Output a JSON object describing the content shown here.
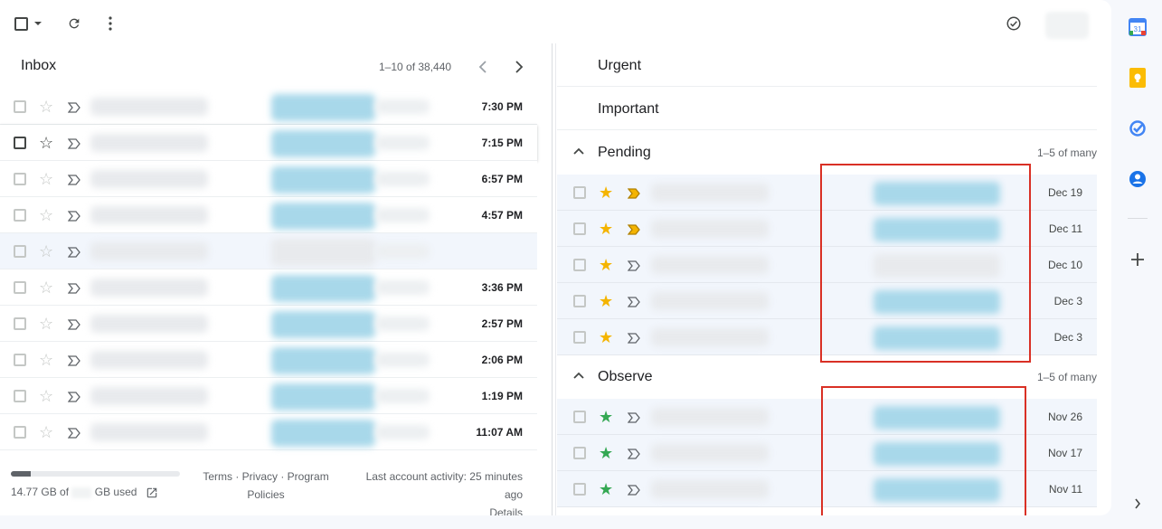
{
  "toolbar": {
    "select_icon": "checkbox-icon",
    "refresh_icon": "refresh-icon",
    "more_icon": "more-vert-icon",
    "tasks_icon": "check-circle-icon"
  },
  "inbox": {
    "title": "Inbox",
    "pager": "1–10 of 38,440",
    "rows": [
      {
        "time": "7:30 PM",
        "read": false
      },
      {
        "time": "7:15 PM",
        "read": false
      },
      {
        "time": "6:57 PM",
        "read": false
      },
      {
        "time": "4:57 PM",
        "read": false
      },
      {
        "time": "",
        "read": true
      },
      {
        "time": "3:36 PM",
        "read": false
      },
      {
        "time": "2:57 PM",
        "read": false
      },
      {
        "time": "2:06 PM",
        "read": false
      },
      {
        "time": "1:19 PM",
        "read": false
      },
      {
        "time": "11:07 AM",
        "read": false
      }
    ]
  },
  "footer": {
    "storage_used": "14.77 GB of",
    "storage_suffix": "GB used",
    "storage_fraction": 0.12,
    "terms": "Terms",
    "privacy": "Privacy",
    "program_policies": "Program Policies",
    "sep": " · ",
    "activity": "Last account activity: 25 minutes ago",
    "details": "Details"
  },
  "sections": {
    "urgent": "Urgent",
    "important": "Important",
    "pending": {
      "title": "Pending",
      "count": "1–5 of many",
      "rows": [
        {
          "date": "Dec 19",
          "important": true
        },
        {
          "date": "Dec 11",
          "important": true
        },
        {
          "date": "Dec 10",
          "important": false
        },
        {
          "date": "Dec 3",
          "important": false
        },
        {
          "date": "Dec 3",
          "important": false
        }
      ]
    },
    "observe": {
      "title": "Observe",
      "count": "1–5 of many",
      "rows": [
        {
          "date": "Nov 26"
        },
        {
          "date": "Nov 17"
        },
        {
          "date": "Nov 11"
        }
      ]
    }
  },
  "colors": {
    "pending_star": "#f4b400",
    "observe_star": "#34a853",
    "important_marker": "#f4b400",
    "highlight_box": "#d93025"
  },
  "side_panel": {
    "icons": [
      "calendar-icon",
      "keep-icon",
      "tasks-icon",
      "contacts-icon",
      "add-icon",
      "chevron-right-icon"
    ],
    "calendar_day": "31"
  }
}
